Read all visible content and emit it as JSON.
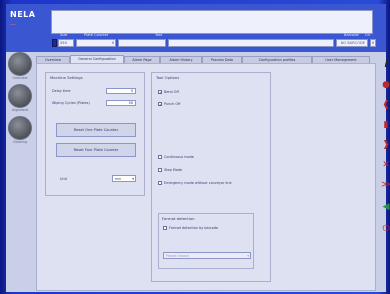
{
  "header": {
    "logo_line1": "NELA",
    "logo_line2": "...",
    "labels": {
      "size": "Size",
      "plate_counter": "Plate Counter",
      "text": "Text",
      "barcode": "Barcode",
      "ctr": "Ctr"
    },
    "size_value": "250",
    "plate_counter_value": "0",
    "barcode_value": "NO BARCODE",
    "ctr_value": "0"
  },
  "tabs": [
    "Overview",
    "General Configuration",
    "Alarm Page",
    "Alarm History",
    "Process Data",
    "Configuration profiles",
    "User Management"
  ],
  "active_tab": 1,
  "left_buttons": [
    {
      "label": "Overview"
    },
    {
      "label": "Alignment"
    },
    {
      "label": "Cleaning"
    }
  ],
  "machine_settings": {
    "title": "Machine Settings",
    "delay_time_label": "Delay time",
    "delay_time_value": "5",
    "wiping_cycles_label": "Wiping Cycles (Plates)",
    "wiping_cycles_value": "50",
    "reset_one_label": "Reset One Plate Counter",
    "reset_four_label": "Reset Four Plate Counter",
    "unit_label": "Unit",
    "unit_value": "mm"
  },
  "tool_options": {
    "title": "Tool Options",
    "punch_on_label": "Bend Off",
    "punch_on_checked": true,
    "bend_on_label": "Punch Off",
    "bend_on_checked": true
  },
  "modes": {
    "continuous_label": "Continuous mode",
    "step_label": "Step Mode",
    "emergency_label": "Emergency mode without conveyor line",
    "continuous_checked": false,
    "step_checked": false,
    "emergency_checked": false
  },
  "format_detection": {
    "title": "Format detection",
    "by_barcode_label": "Format detection by barcode",
    "by_barcode_checked": false,
    "select_placeholder": "Please choose"
  },
  "colors": {
    "frame": "#1e36c8",
    "header": "#3b56d1",
    "panel": "#dde1f1"
  }
}
